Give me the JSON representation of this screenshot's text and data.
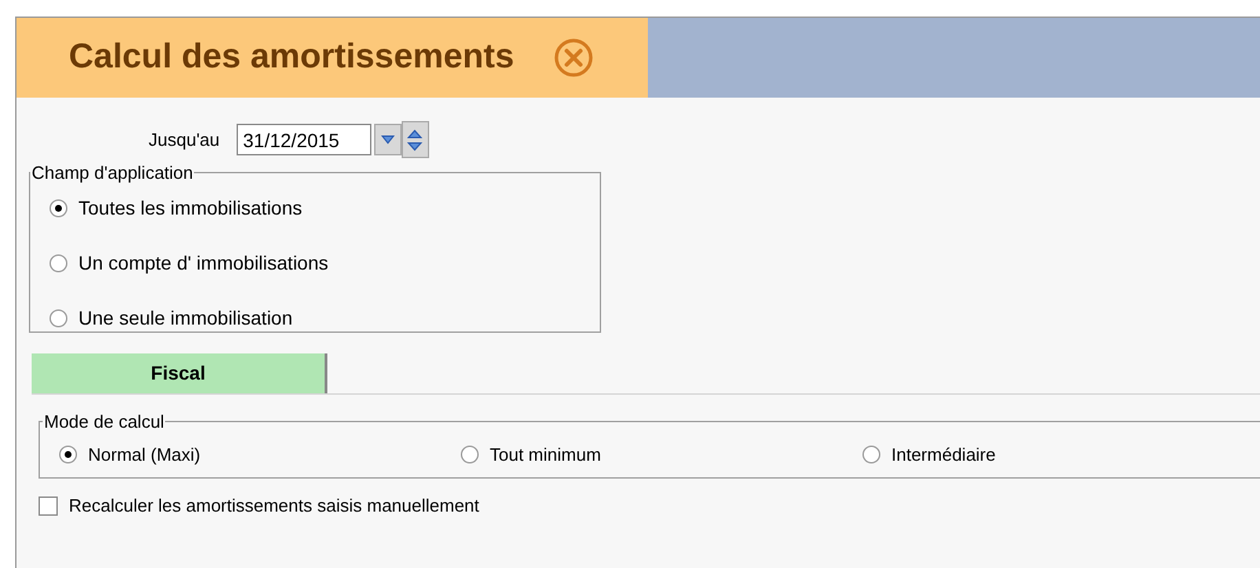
{
  "window": {
    "title": "Calcul des amortissements"
  },
  "date_field": {
    "label": "Jusqu'au",
    "value": "31/12/2015"
  },
  "scope_group": {
    "title": "Champ d'application",
    "options": [
      {
        "label": "Toutes les immobilisations",
        "selected": true
      },
      {
        "label": "Un compte d' immobilisations",
        "selected": false
      },
      {
        "label": "Une seule immobilisation",
        "selected": false
      }
    ]
  },
  "tabs": [
    {
      "label": "Fiscal",
      "selected": true
    }
  ],
  "mode_group": {
    "title": "Mode de calcul",
    "options": [
      {
        "label": "Normal (Maxi)",
        "selected": true
      },
      {
        "label": "Tout minimum",
        "selected": false
      },
      {
        "label": "Intermédiaire",
        "selected": false
      }
    ]
  },
  "recalc_checkbox": {
    "label": "Recalculer les amortissements saisis manuellement",
    "checked": false
  }
}
